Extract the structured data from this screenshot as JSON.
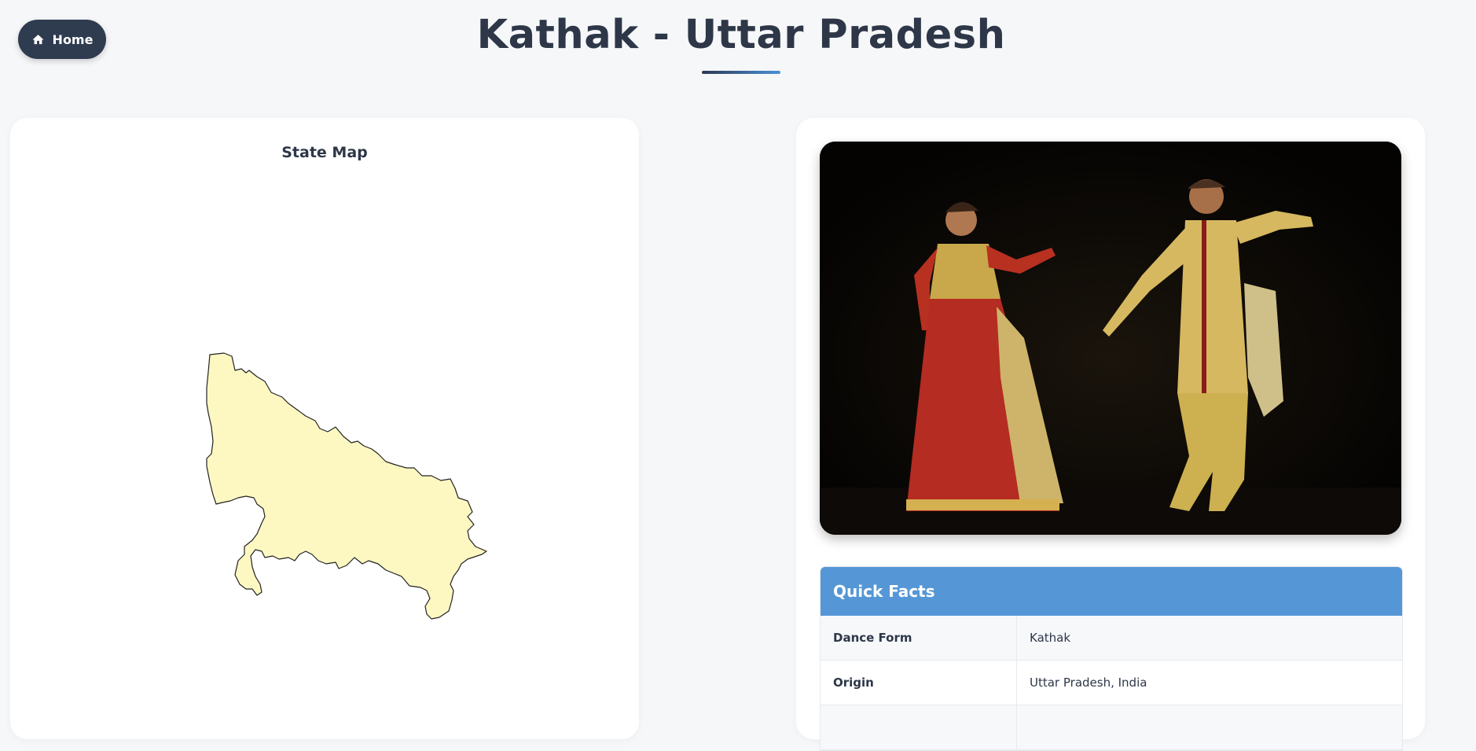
{
  "header": {
    "home_label": "Home",
    "title": "Kathak - Uttar Pradesh"
  },
  "map_panel": {
    "title": "State Map",
    "fill_color": "#fdf8c2",
    "stroke_color": "#222222"
  },
  "photo": {
    "alt": "Kathak dancers performing on stage"
  },
  "quick_facts": {
    "title": "Quick Facts",
    "header_color": "#5597d6",
    "rows": [
      {
        "label": "Dance Form",
        "value": "Kathak"
      },
      {
        "label": "Origin",
        "value": "Uttar Pradesh, India"
      },
      {
        "label": "",
        "value": ""
      }
    ]
  },
  "colors": {
    "page_bg": "#f6f7f9",
    "home_button_bg": "#2f3b4f",
    "title_text": "#2d3748",
    "underline_start": "#2d3a50",
    "underline_end": "#4a90d9"
  },
  "icons": {
    "home": "house-icon"
  }
}
